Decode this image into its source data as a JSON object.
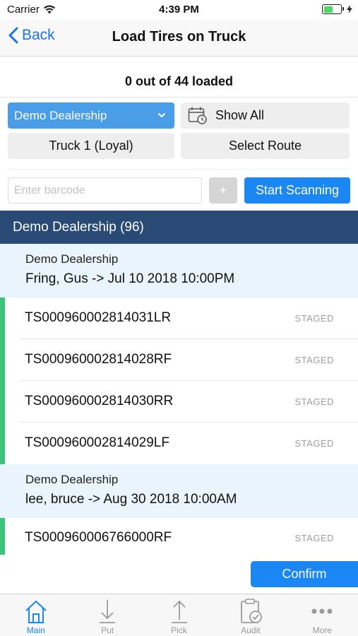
{
  "status_bar": {
    "carrier": "Carrier",
    "time": "4:39 PM"
  },
  "nav": {
    "back_label": "Back",
    "title": "Load Tires on Truck"
  },
  "summary": {
    "loaded_text": "0 out of 44 loaded"
  },
  "controls": {
    "dealership_select": "Demo Dealership",
    "show_all_label": "Show All",
    "truck_label": "Truck 1 (Loyal)",
    "route_label": "Select Route",
    "barcode_placeholder": "Enter barcode",
    "plus_label": "+",
    "scan_label": "Start Scanning"
  },
  "section": {
    "header": "Demo Dealership (96)"
  },
  "groups": [
    {
      "dealer": "Demo Dealership",
      "customer": "Fring, Gus -> Jul 10 2018 10:00PM",
      "tires": [
        {
          "code": "TS000960002814031LR",
          "status": "STAGED"
        },
        {
          "code": "TS000960002814028RF",
          "status": "STAGED"
        },
        {
          "code": "TS000960002814030RR",
          "status": "STAGED"
        },
        {
          "code": "TS000960002814029LF",
          "status": "STAGED"
        }
      ]
    },
    {
      "dealer": "Demo Dealership",
      "customer": "lee, bruce -> Aug 30 2018 10:00AM",
      "tires": [
        {
          "code": "TS000960006766000RF",
          "status": "STAGED"
        }
      ]
    }
  ],
  "confirm_label": "Confirm",
  "tabs": [
    {
      "label": "Main",
      "icon": "home-icon",
      "active": true
    },
    {
      "label": "Put",
      "icon": "arrow-down-icon",
      "active": false
    },
    {
      "label": "Pick",
      "icon": "arrow-up-icon",
      "active": false
    },
    {
      "label": "Audit",
      "icon": "clipboard-check-icon",
      "active": false
    },
    {
      "label": "More",
      "icon": "more-dots-icon",
      "active": false
    }
  ],
  "colors": {
    "accent": "#1b87f5",
    "section_header": "#284a74",
    "group_header_bg": "#e9f4fd",
    "staged_bar": "#3cc37a",
    "dealer_select": "#4a9ee8"
  }
}
